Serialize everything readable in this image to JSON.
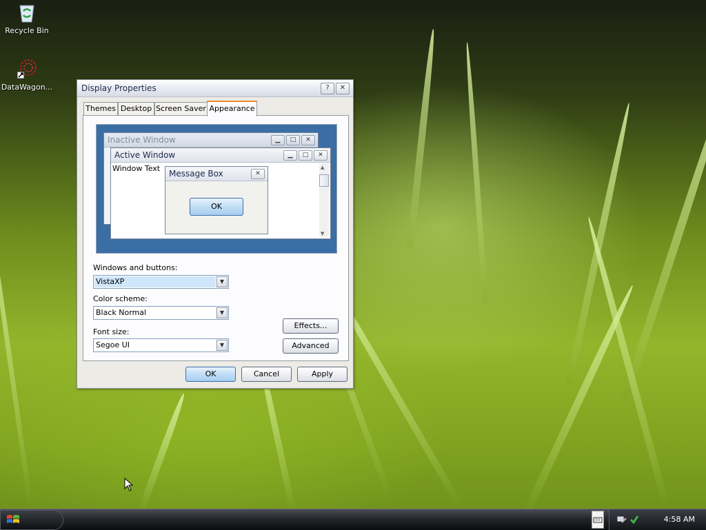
{
  "desktop": {
    "icons": [
      {
        "label": "Recycle Bin",
        "icon": "recycle-bin-icon"
      },
      {
        "label": "DataWagon...",
        "icon": "datawagon-app-icon"
      }
    ]
  },
  "window": {
    "title": "Display Properties",
    "help_glyph": "?",
    "close_glyph": "✕",
    "tabs": [
      {
        "label": "Themes"
      },
      {
        "label": "Desktop"
      },
      {
        "label": "Screen Saver"
      },
      {
        "label": "Appearance",
        "active": true
      }
    ],
    "preview": {
      "inactive_title": "Inactive Window",
      "active_title": "Active Window",
      "window_text": "Window Text",
      "message_box_title": "Message Box",
      "message_ok": "OK",
      "minimize_glyph": "▁",
      "maximize_glyph": "□",
      "close_glyph": "✕",
      "scroll_up_glyph": "▲",
      "scroll_down_glyph": "▼"
    },
    "fields": {
      "windows_buttons_label": "Windows and buttons:",
      "windows_buttons_value": "VistaXP",
      "color_scheme_label": "Color scheme:",
      "color_scheme_value": "Black Normal",
      "font_size_label": "Font size:",
      "font_size_value": "Segoe UI",
      "dropdown_glyph": "▼"
    },
    "buttons": {
      "effects": "Effects...",
      "advanced": "Advanced",
      "ok": "OK",
      "cancel": "Cancel",
      "apply": "Apply"
    }
  },
  "taskbar": {
    "clock": "4:58 AM",
    "tray_icons": [
      "keyboard-icon",
      "network-icon",
      "security-icon"
    ]
  },
  "colors": {
    "preview_desktop": "#3a6ea5",
    "active_tab_accent": "#e68b2c",
    "primary_button": "#a6cdf0"
  }
}
